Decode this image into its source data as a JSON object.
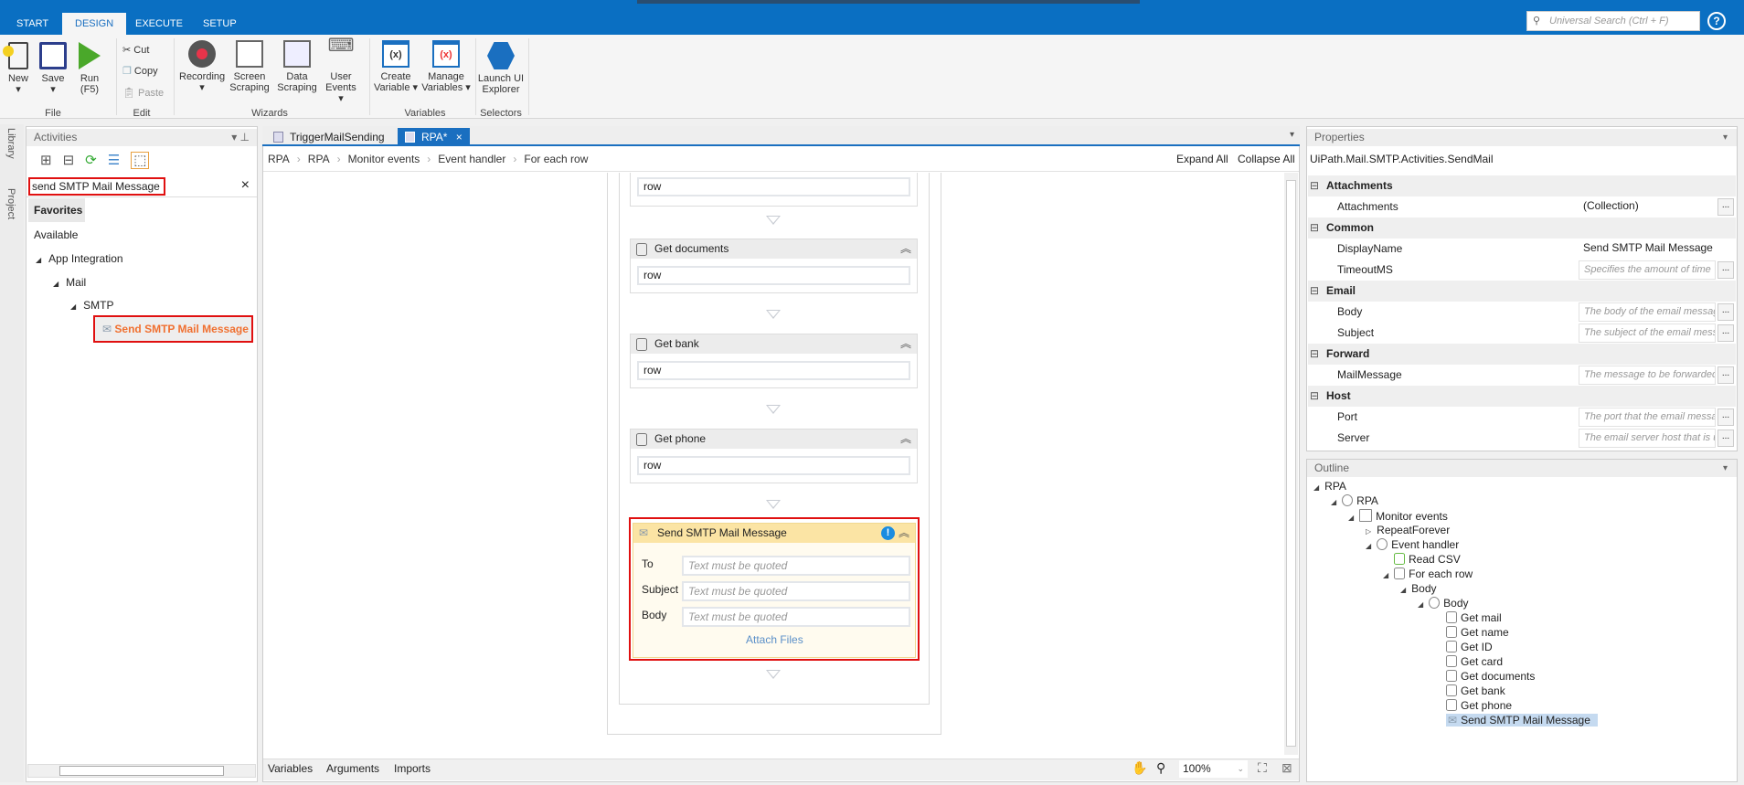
{
  "ribbon_tabs": [
    "START",
    "DESIGN",
    "EXECUTE",
    "SETUP"
  ],
  "search_placeholder": "Universal Search (Ctrl + F)",
  "help": "?",
  "ribbon": {
    "new": "New",
    "save": "Save",
    "run": "Run",
    "run_key": "(F5)",
    "cut": "Cut",
    "copy": "Copy",
    "paste": "Paste",
    "recording": "Recording",
    "screen": "Screen",
    "scraping": "Scraping",
    "data": "Data",
    "data_scraping": "Scraping",
    "user": "User",
    "events": "Events",
    "create": "Create",
    "variable": "Variable",
    "manage": "Manage",
    "variables": "Variables",
    "launch": "Launch UI",
    "explorer": "Explorer",
    "groups": {
      "file": "File",
      "edit": "Edit",
      "wizards": "Wizards",
      "variables": "Variables",
      "selectors": "Selectors"
    }
  },
  "side_tabs": [
    "Library",
    "Project"
  ],
  "activities": {
    "title": "Activities",
    "search_value": "send SMTP Mail Message",
    "clear": "×",
    "favorites": "Favorites",
    "available": "Available",
    "tree": [
      "App Integration",
      "Mail",
      "SMTP",
      "Send SMTP Mail Message"
    ]
  },
  "designer": {
    "tabs": [
      "TriggerMailSending",
      "RPA*"
    ],
    "tab_close": "×",
    "breadcrumb": [
      "RPA",
      "RPA",
      "Monitor events",
      "Event handler",
      "For each row"
    ],
    "expand_all": "Expand All",
    "collapse_all": "Collapse All",
    "cards": [
      {
        "title": "",
        "value": "row"
      },
      {
        "title": "Get documents",
        "value": "row"
      },
      {
        "title": "Get bank",
        "value": "row"
      },
      {
        "title": "Get phone",
        "value": "row"
      }
    ],
    "send": {
      "title": "Send SMTP Mail Message",
      "fields": [
        {
          "label": "To",
          "placeholder": "Text must be quoted"
        },
        {
          "label": "Subject",
          "placeholder": "Text must be quoted"
        },
        {
          "label": "Body",
          "placeholder": "Text must be quoted"
        }
      ],
      "attach": "Attach Files"
    },
    "bottom": {
      "variables": "Variables",
      "arguments": "Arguments",
      "imports": "Imports",
      "zoom": "100%"
    }
  },
  "properties": {
    "title": "Properties",
    "type": "UiPath.Mail.SMTP.Activities.SendMail",
    "rows": [
      {
        "cat": "Attachments"
      },
      {
        "name": "Attachments",
        "value": "(Collection)",
        "plain": true,
        "dots": true
      },
      {
        "cat": "Common"
      },
      {
        "name": "DisplayName",
        "value": "Send SMTP Mail Message",
        "plain": true
      },
      {
        "name": "TimeoutMS",
        "value": "Specifies the amount of time",
        "dots": true
      },
      {
        "cat": "Email"
      },
      {
        "name": "Body",
        "value": "The body of the email message",
        "dots": true
      },
      {
        "name": "Subject",
        "value": "The subject of the email message",
        "dots": true
      },
      {
        "cat": "Forward"
      },
      {
        "name": "MailMessage",
        "value": "The message to be forwarded",
        "dots": true
      },
      {
        "cat": "Host"
      },
      {
        "name": "Port",
        "value": "The port that the email message",
        "dots": true
      },
      {
        "name": "Server",
        "value": "The email server host that is used",
        "dots": true
      }
    ]
  },
  "outline": {
    "title": "Outline",
    "items": [
      {
        "label": "RPA",
        "level": 0,
        "tri": "◢"
      },
      {
        "label": "RPA",
        "level": 1,
        "tri": "◢",
        "icon": "seq"
      },
      {
        "label": "Monitor events",
        "level": 2,
        "tri": "◢",
        "icon": "clock"
      },
      {
        "label": "RepeatForever",
        "level": 3,
        "tri": "▷"
      },
      {
        "label": "Event handler",
        "level": 3,
        "tri": "◢",
        "icon": "seq"
      },
      {
        "label": "Read CSV",
        "level": 4,
        "icon": "csv"
      },
      {
        "label": "For each row",
        "level": 4,
        "tri": "◢",
        "icon": "db"
      },
      {
        "label": "Body",
        "level": 5,
        "tri": "◢"
      },
      {
        "label": "Body",
        "level": 6,
        "tri": "◢",
        "icon": "seq"
      },
      {
        "label": "Get mail",
        "level": 7,
        "icon": "db"
      },
      {
        "label": "Get name",
        "level": 7,
        "icon": "db"
      },
      {
        "label": "Get ID",
        "level": 7,
        "icon": "db"
      },
      {
        "label": "Get card",
        "level": 7,
        "icon": "db"
      },
      {
        "label": "Get documents",
        "level": 7,
        "icon": "db"
      },
      {
        "label": "Get bank",
        "level": 7,
        "icon": "db"
      },
      {
        "label": "Get phone",
        "level": 7,
        "icon": "db"
      },
      {
        "label": "Send SMTP Mail Message",
        "level": 7,
        "icon": "mail",
        "selected": true
      }
    ]
  }
}
